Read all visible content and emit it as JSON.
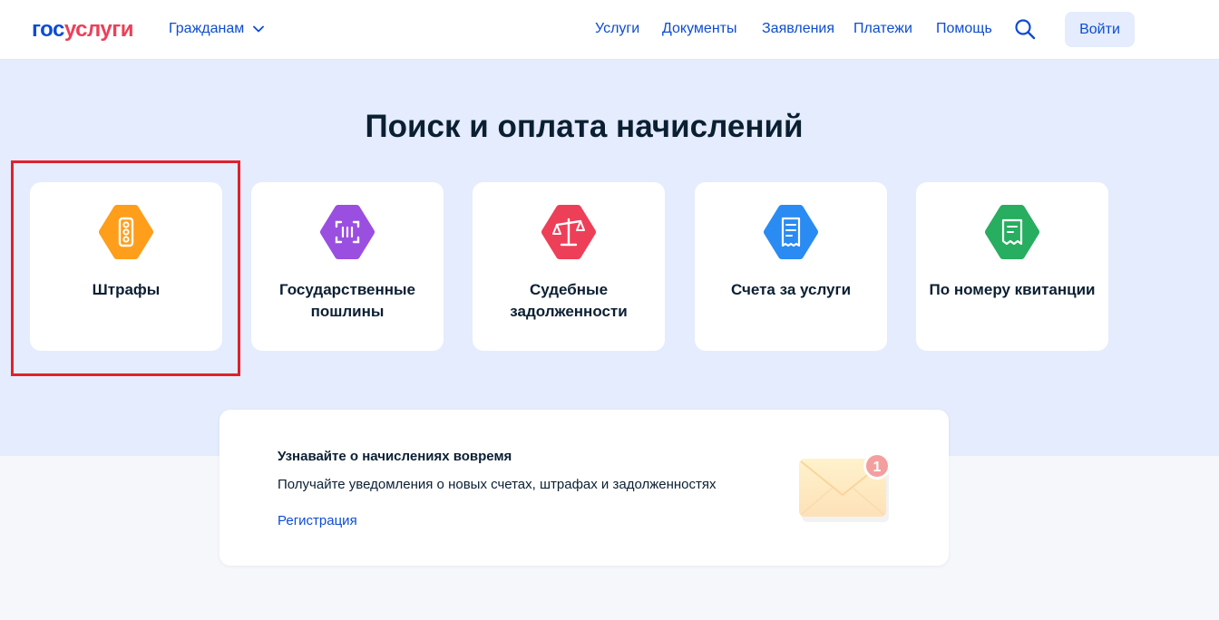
{
  "header": {
    "logo_part1": "гос",
    "logo_part2": "услуги",
    "role_label": "Гражданам",
    "nav": [
      "Услуги",
      "Документы",
      "Заявления",
      "Платежи",
      "Помощь"
    ],
    "login_label": "Войти"
  },
  "hero": {
    "title": "Поиск и оплата начислений"
  },
  "cards": [
    {
      "label": "Штрафы",
      "icon": "traffic-light-icon",
      "color": "#ff9e1b"
    },
    {
      "label": "Государственные пошлины",
      "icon": "scan-receipt-icon",
      "color": "#9a4fe0"
    },
    {
      "label": "Судебные задолженности",
      "icon": "scales-icon",
      "color": "#ee3f58"
    },
    {
      "label": "Счета за услуги",
      "icon": "bill-icon",
      "color": "#2a8bf2"
    },
    {
      "label": "По номеру квитанции",
      "icon": "receipt-icon",
      "color": "#27ae60"
    }
  ],
  "notification": {
    "title": "Узнавайте о начислениях вовремя",
    "text": "Получайте уведомления о новых счетах, штрафах и задолженностях",
    "link": "Регистрация",
    "badge_count": "1"
  },
  "colors": {
    "brand_blue": "#0d4cd3",
    "brand_red": "#ee3f58",
    "hero_bg": "#e4ecfd",
    "highlight": "#e0202e"
  }
}
